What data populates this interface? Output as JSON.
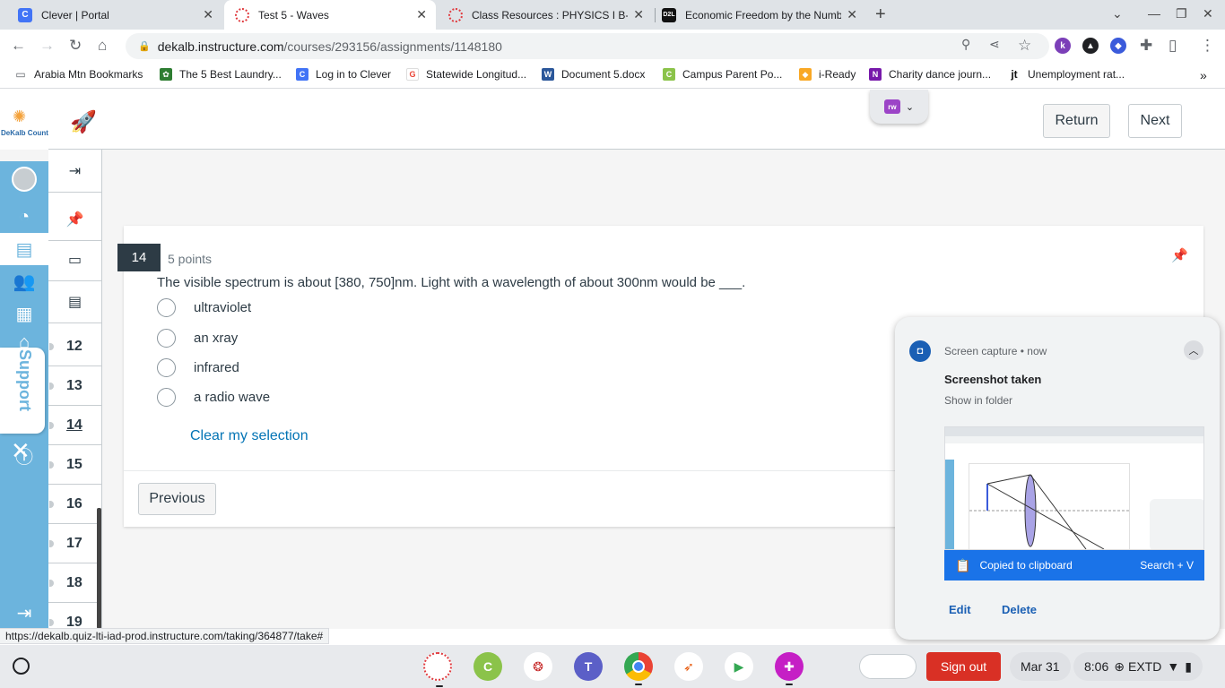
{
  "tabs": [
    {
      "title": "Clever | Portal",
      "favicon": "C"
    },
    {
      "title": "Test 5 - Waves",
      "favicon": ""
    },
    {
      "title": "Class Resources : PHYSICS I B-M",
      "favicon": ""
    },
    {
      "title": "Economic Freedom by the Numb",
      "favicon": "D2L"
    }
  ],
  "address": {
    "host": "dekalb.instructure.com",
    "path": "/courses/293156/assignments/1148180"
  },
  "bookmarks": [
    "Arabia Mtn Bookmarks",
    "The 5 Best Laundry...",
    "Log in to Clever",
    "Statewide Longitud...",
    "Document 5.docx",
    "Campus Parent Po...",
    "i-Ready",
    "Charity dance journ...",
    "Unemployment rat..."
  ],
  "logo_text": "DeKalb County",
  "header": {
    "return_label": "Return",
    "next_label": "Next"
  },
  "support_label": "Support",
  "question_nav": [
    "12",
    "13",
    "14",
    "15",
    "16",
    "17",
    "18",
    "19"
  ],
  "question": {
    "number": "14",
    "points": "5 points",
    "text": "The visible spectrum is about [380, 750]nm. Light with a wavelength of about 300nm would be ___.",
    "answers": [
      "ultraviolet",
      "an xray",
      "infrared",
      "a radio wave"
    ],
    "clear_label": "Clear my selection"
  },
  "footer": {
    "previous_label": "Previous"
  },
  "status_url": "https://dekalb.quiz-lti-iad-prod.instructure.com/taking/364877/take#",
  "notification": {
    "source": "Screen capture",
    "time": "now",
    "title": "Screenshot taken",
    "subtitle": "Show in folder",
    "clipboard_label": "Copied to clipboard",
    "shortcut": "Search + V",
    "edit_label": "Edit",
    "delete_label": "Delete"
  },
  "shelf": {
    "sign_out": "Sign out",
    "date": "Mar 31",
    "time": "8:06",
    "layout": "EXTD"
  },
  "colors": {
    "canvas_nav": "#6cb4dd",
    "link": "#0374b5",
    "sign_out": "#d93025"
  }
}
